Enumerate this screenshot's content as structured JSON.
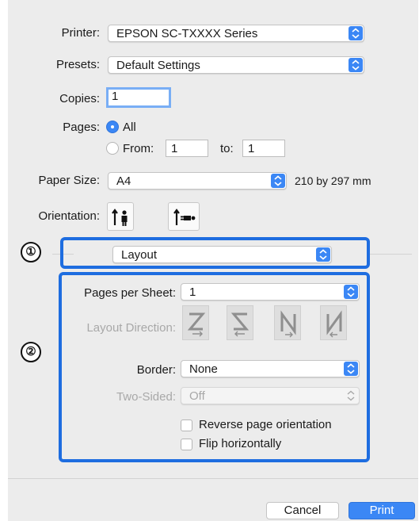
{
  "printer": {
    "label": "Printer:",
    "value": "EPSON SC-TXXXX Series"
  },
  "presets": {
    "label": "Presets:",
    "value": "Default Settings"
  },
  "copies": {
    "label": "Copies:",
    "value": "1"
  },
  "pages": {
    "label": "Pages:",
    "all_label": "All",
    "from_label": "From:",
    "from_value": "1",
    "to_label": "to:",
    "to_value": "1"
  },
  "paper_size": {
    "label": "Paper Size:",
    "value": "A4",
    "dimensions": "210 by 297 mm"
  },
  "orientation": {
    "label": "Orientation:",
    "portrait_icon": "portrait-orientation-icon",
    "landscape_icon": "landscape-orientation-icon"
  },
  "section_menu": {
    "value": "Layout"
  },
  "layout": {
    "pages_per_sheet": {
      "label": "Pages per Sheet:",
      "value": "1"
    },
    "layout_direction": {
      "label": "Layout Direction:",
      "icons": [
        "z-direction-icon",
        "reverse-z-direction-icon",
        "n-down-direction-icon",
        "n-reverse-direction-icon"
      ]
    },
    "border": {
      "label": "Border:",
      "value": "None"
    },
    "two_sided": {
      "label": "Two-Sided:",
      "value": "Off"
    },
    "reverse_orientation": {
      "label": "Reverse page orientation",
      "checked": false
    },
    "flip_horizontally": {
      "label": "Flip horizontally",
      "checked": false
    }
  },
  "callouts": {
    "marker_1": "①",
    "marker_2": "②"
  },
  "buttons": {
    "cancel": "Cancel",
    "print": "Print"
  },
  "colors": {
    "accent": "#3b87f5",
    "callout": "#1e6de0",
    "panel": "#ececec"
  }
}
